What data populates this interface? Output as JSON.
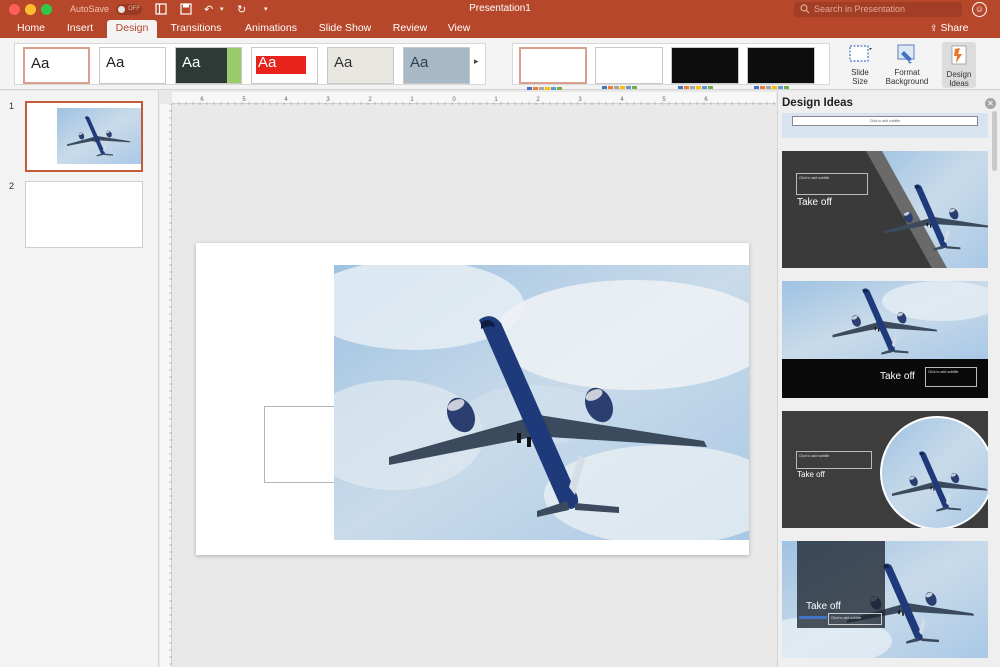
{
  "titlebar": {
    "autosave_label": "AutoSave",
    "autosave_state": "OFF",
    "title": "Presentation1",
    "search_placeholder": "Search in Presentation"
  },
  "tabs": [
    {
      "label": "Home"
    },
    {
      "label": "Insert"
    },
    {
      "label": "Design"
    },
    {
      "label": "Transitions"
    },
    {
      "label": "Animations"
    },
    {
      "label": "Slide Show"
    },
    {
      "label": "Review"
    },
    {
      "label": "View"
    }
  ],
  "active_tab": "Design",
  "share_label": "Share",
  "ribbon": {
    "theme_sample": "Aa",
    "slide_size_label": "Slide Size",
    "format_background_label": "Format Background",
    "design_ideas_label": "Design Ideas"
  },
  "slides": [
    {
      "number": "1"
    },
    {
      "number": "2"
    }
  ],
  "ruler_numbers": [
    "6",
    "5",
    "4",
    "3",
    "2",
    "1",
    "0",
    "1",
    "2",
    "3",
    "4",
    "5",
    "6"
  ],
  "design_ideas": {
    "title": "Design Ideas",
    "subtitle_placeholder": "Click to add subtitle",
    "idea_title": "Take off"
  },
  "colors": {
    "accent": "#b7472a",
    "ribbon_bg": "#f3f3f3",
    "selection": "#c55a3b"
  }
}
